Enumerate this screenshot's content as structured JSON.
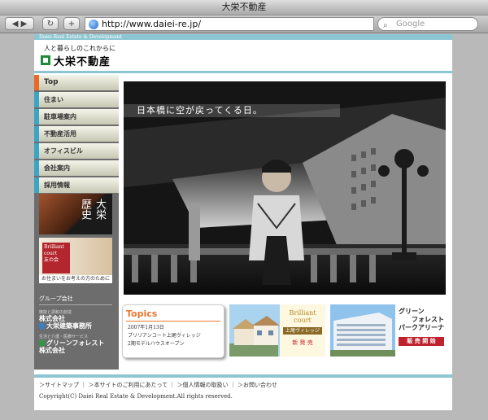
{
  "window": {
    "title": "大栄不動産"
  },
  "toolbar": {
    "url": "http://www.daiei-re.jp/",
    "search_placeholder": "Google",
    "add_label": "+"
  },
  "site": {
    "top_strip": "Daiei Real Estate & Development",
    "tagline": "人と暮らしのこれからに",
    "logo_name": "大栄不動産"
  },
  "nav": [
    {
      "label": "Top"
    },
    {
      "label": "住まい"
    },
    {
      "label": "駐車場案内"
    },
    {
      "label": "不動産活用"
    },
    {
      "label": "オフィスビル"
    },
    {
      "label": "会社案内"
    },
    {
      "label": "採用情報"
    }
  ],
  "sidebar": {
    "history_banner": {
      "line1": "大栄",
      "line2": "歴史"
    },
    "brilliant_banner": {
      "logo": "Brilliant court",
      "club": "友の会",
      "caption": "お住まいをお考えの方のために"
    },
    "group_head": "グループ会社",
    "group1": {
      "sub": "機能と調和の創造",
      "name1": "株式会社",
      "name2": "大栄建築事務所"
    },
    "group2": {
      "sub": "生活と介護・医療サービス",
      "name1": "グリーンフォレスト",
      "name2": "株式会社"
    }
  },
  "hero": {
    "title": "日本橋に空が戻ってくる日。"
  },
  "topics": {
    "heading": "Topics",
    "date": "2007年1月13日",
    "line1": "ブリリアンコート上尾ヴィレッジ",
    "line2": "2期モデルハウスオープン"
  },
  "promo2": {
    "logo": "Brilliant court",
    "sub": "上尾ヴィレッジ",
    "tag": "新 発 売"
  },
  "promo3": {
    "line1": "グリーン",
    "line2": "フォレスト",
    "line3": "パークアリーナ",
    "tag": "販 売 開 始"
  },
  "footer": {
    "links": [
      "＞サイトマップ",
      "＞本サイトのご利用にあたって",
      "＞個人情報の取扱い",
      "＞お問い合わせ"
    ],
    "copyright": "Copyright(C) Daiei Real Estate & Development.All rights reserved."
  },
  "colors": {
    "accent": "#8dc6d3",
    "nav_active": "#e86b24",
    "nav_marker": "#3aa6c4",
    "logo_green": "#1f8a3b"
  }
}
